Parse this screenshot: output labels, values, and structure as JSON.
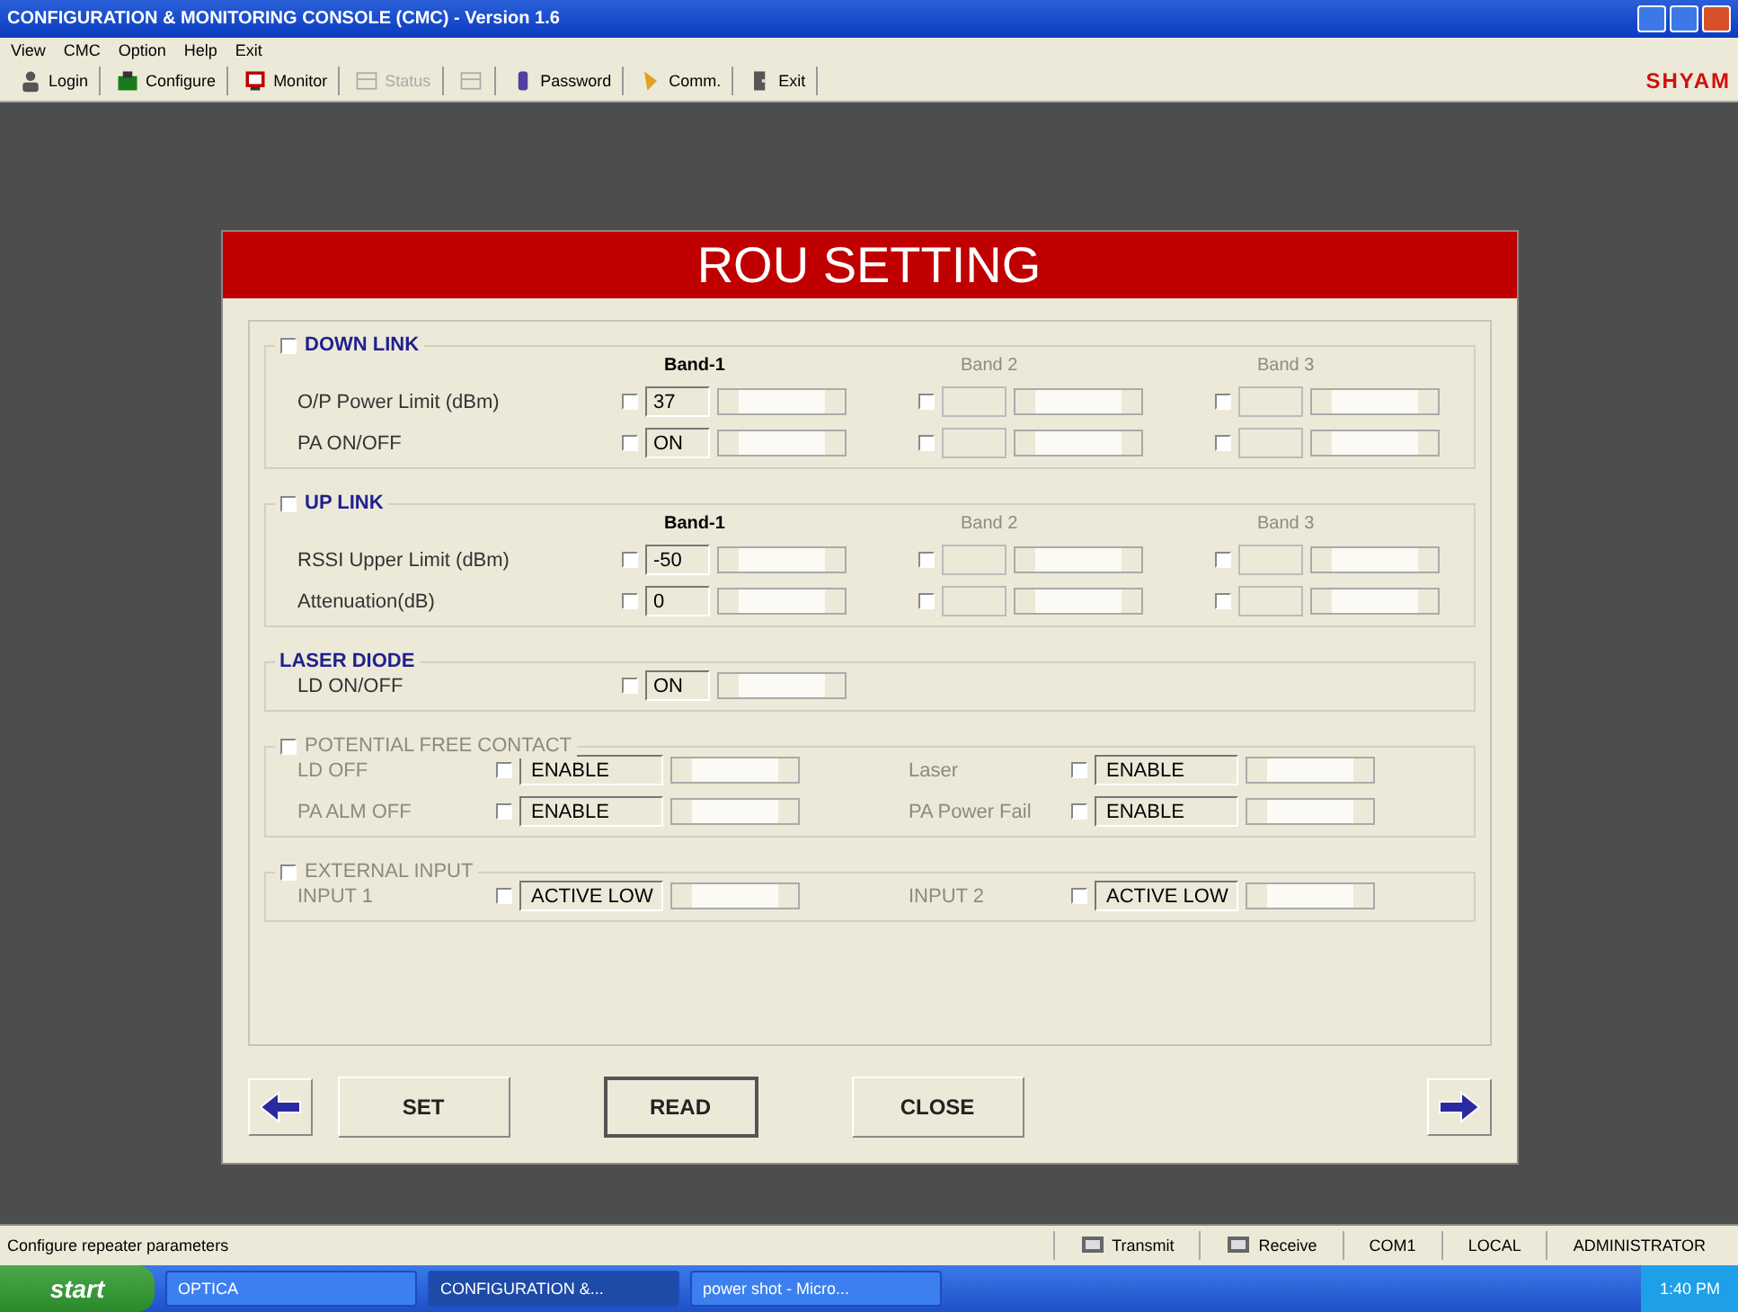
{
  "window": {
    "title": "CONFIGURATION & MONITORING CONSOLE (CMC) - Version 1.6"
  },
  "menu": [
    "View",
    "CMC",
    "Option",
    "Help",
    "Exit"
  ],
  "toolbar": [
    {
      "label": "Login",
      "disabled": false
    },
    {
      "label": "Configure",
      "disabled": false
    },
    {
      "label": "Monitor",
      "disabled": false
    },
    {
      "label": "Status",
      "disabled": true
    },
    {
      "disabled": true
    },
    {
      "label": "Password",
      "disabled": false
    },
    {
      "label": "Comm.",
      "disabled": false
    },
    {
      "label": "Exit",
      "disabled": false
    }
  ],
  "brand": "SHYAM",
  "dialog": {
    "title": "ROU SETTING",
    "sections": [
      {
        "kind": "grid",
        "title": "DOWN LINK",
        "checked": false,
        "disabled": false,
        "band_headers": [
          {
            "label": "Band-1",
            "disabled": false
          },
          {
            "label": "Band 2",
            "disabled": true
          },
          {
            "label": "Band 3",
            "disabled": true
          }
        ],
        "rows": [
          {
            "label": "O/P Power Limit (dBm)",
            "cells": [
              {
                "checked": false,
                "value": "37",
                "disabled": false
              },
              {
                "checked": false,
                "disabled": true
              },
              {
                "checked": false,
                "disabled": true
              }
            ]
          },
          {
            "label": "PA ON/OFF",
            "cells": [
              {
                "checked": false,
                "value": "ON",
                "disabled": false
              },
              {
                "checked": false,
                "disabled": true
              },
              {
                "checked": false,
                "disabled": true
              }
            ]
          }
        ]
      },
      {
        "kind": "grid",
        "title": "UP LINK",
        "checked": false,
        "disabled": false,
        "band_headers": [
          {
            "label": "Band-1",
            "disabled": false
          },
          {
            "label": "Band 2",
            "disabled": true
          },
          {
            "label": "Band 3",
            "disabled": true
          }
        ],
        "rows": [
          {
            "label": "RSSI Upper Limit (dBm)",
            "cells": [
              {
                "checked": false,
                "value": "-50",
                "disabled": false
              },
              {
                "checked": false,
                "disabled": true
              },
              {
                "checked": false,
                "disabled": true
              }
            ]
          },
          {
            "label": "Attenuation(dB)",
            "cells": [
              {
                "checked": false,
                "value": "0",
                "disabled": false
              },
              {
                "checked": false,
                "disabled": true
              },
              {
                "checked": false,
                "disabled": true
              }
            ]
          }
        ]
      },
      {
        "kind": "grid",
        "title": "LASER DIODE",
        "disabled": false,
        "rows": [
          {
            "label": "LD ON/OFF",
            "cells": [
              {
                "checked": false,
                "value": "ON",
                "disabled": false
              }
            ]
          }
        ]
      },
      {
        "kind": "pairs",
        "title": "POTENTIAL FREE CONTACT",
        "checked": false,
        "disabled": true,
        "rows": [
          {
            "cells": [
              {
                "label": "LD OFF",
                "checked": false,
                "value": "ENABLE"
              },
              {
                "label": "Laser",
                "checked": false,
                "value": "ENABLE"
              }
            ]
          },
          {
            "cells": [
              {
                "label": "PA ALM OFF",
                "checked": false,
                "value": "ENABLE"
              },
              {
                "label": "PA Power Fail",
                "checked": false,
                "value": "ENABLE"
              }
            ]
          }
        ]
      },
      {
        "kind": "pairs",
        "title": "EXTERNAL INPUT",
        "checked": false,
        "disabled": true,
        "rows": [
          {
            "cells": [
              {
                "label": "INPUT 1",
                "checked": false,
                "value": "ACTIVE LOW"
              },
              {
                "label": "INPUT 2",
                "checked": false,
                "value": "ACTIVE LOW"
              }
            ]
          }
        ]
      }
    ],
    "buttons": [
      {
        "label": "SET",
        "focused": false
      },
      {
        "label": "READ",
        "focused": true
      },
      {
        "label": "CLOSE",
        "focused": false
      }
    ]
  },
  "status_bar": {
    "message": "Configure repeater parameters",
    "indicators": [
      {
        "kind": "icon",
        "label": "Transmit"
      },
      {
        "kind": "icon",
        "label": "Receive"
      },
      {
        "kind": "text",
        "label": "COM1"
      },
      {
        "kind": "text",
        "label": "LOCAL"
      },
      {
        "kind": "text",
        "label": "ADMINISTRATOR"
      }
    ]
  },
  "taskbar": {
    "start": "start",
    "tasks": [
      {
        "label": "OPTICA",
        "selected": false
      },
      {
        "label": "CONFIGURATION &...",
        "selected": true
      },
      {
        "label": "power shot - Micro...",
        "selected": false
      }
    ],
    "clock": "1:40 PM"
  }
}
